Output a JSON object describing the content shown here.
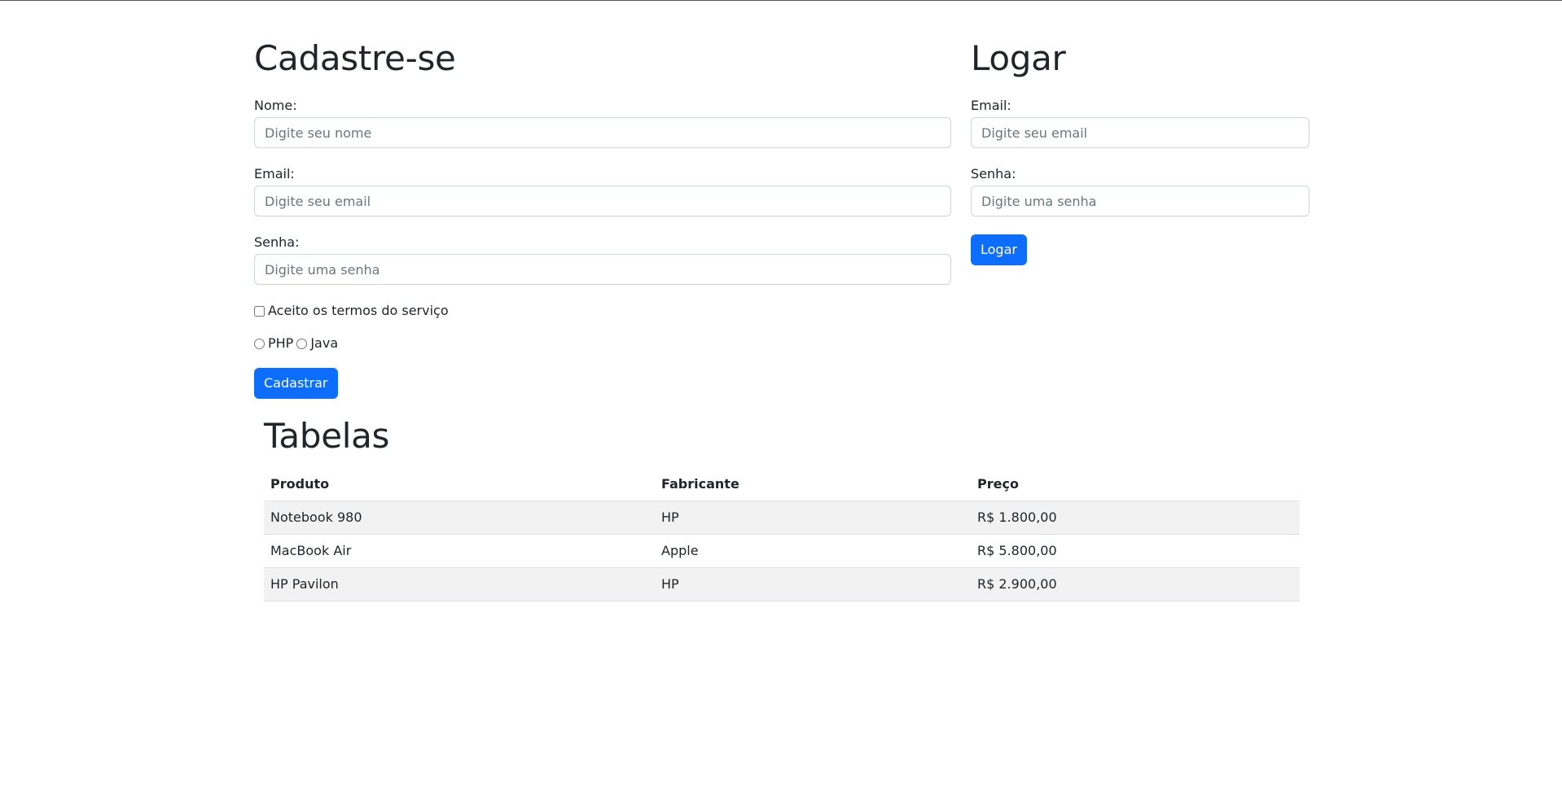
{
  "register": {
    "title": "Cadastre-se",
    "name_label": "Nome:",
    "name_placeholder": "Digite seu nome",
    "email_label": "Email:",
    "email_placeholder": "Digite seu email",
    "password_label": "Senha:",
    "password_placeholder": "Digite uma senha",
    "terms_label": "Aceito os termos do serviço",
    "terms_checked": false,
    "radio_options": [
      "PHP",
      "Java"
    ],
    "submit_label": "Cadastrar"
  },
  "login": {
    "title": "Logar",
    "email_label": "Email:",
    "email_placeholder": "Digite seu email",
    "password_label": "Senha:",
    "password_placeholder": "Digite uma senha",
    "submit_label": "Logar"
  },
  "tables": {
    "title": "Tabelas",
    "columns": [
      "Produto",
      "Fabricante",
      "Preço"
    ],
    "rows": [
      [
        "Notebook 980",
        "HP",
        "R$ 1.800,00"
      ],
      [
        "MacBook Air",
        "Apple",
        "R$ 5.800,00"
      ],
      [
        "HP Pavilon",
        "HP",
        "R$ 2.900,00"
      ]
    ]
  },
  "colors": {
    "primary": "#0d6efd",
    "stripe": "#f2f2f2",
    "border": "#ced4da",
    "text": "#212529"
  }
}
